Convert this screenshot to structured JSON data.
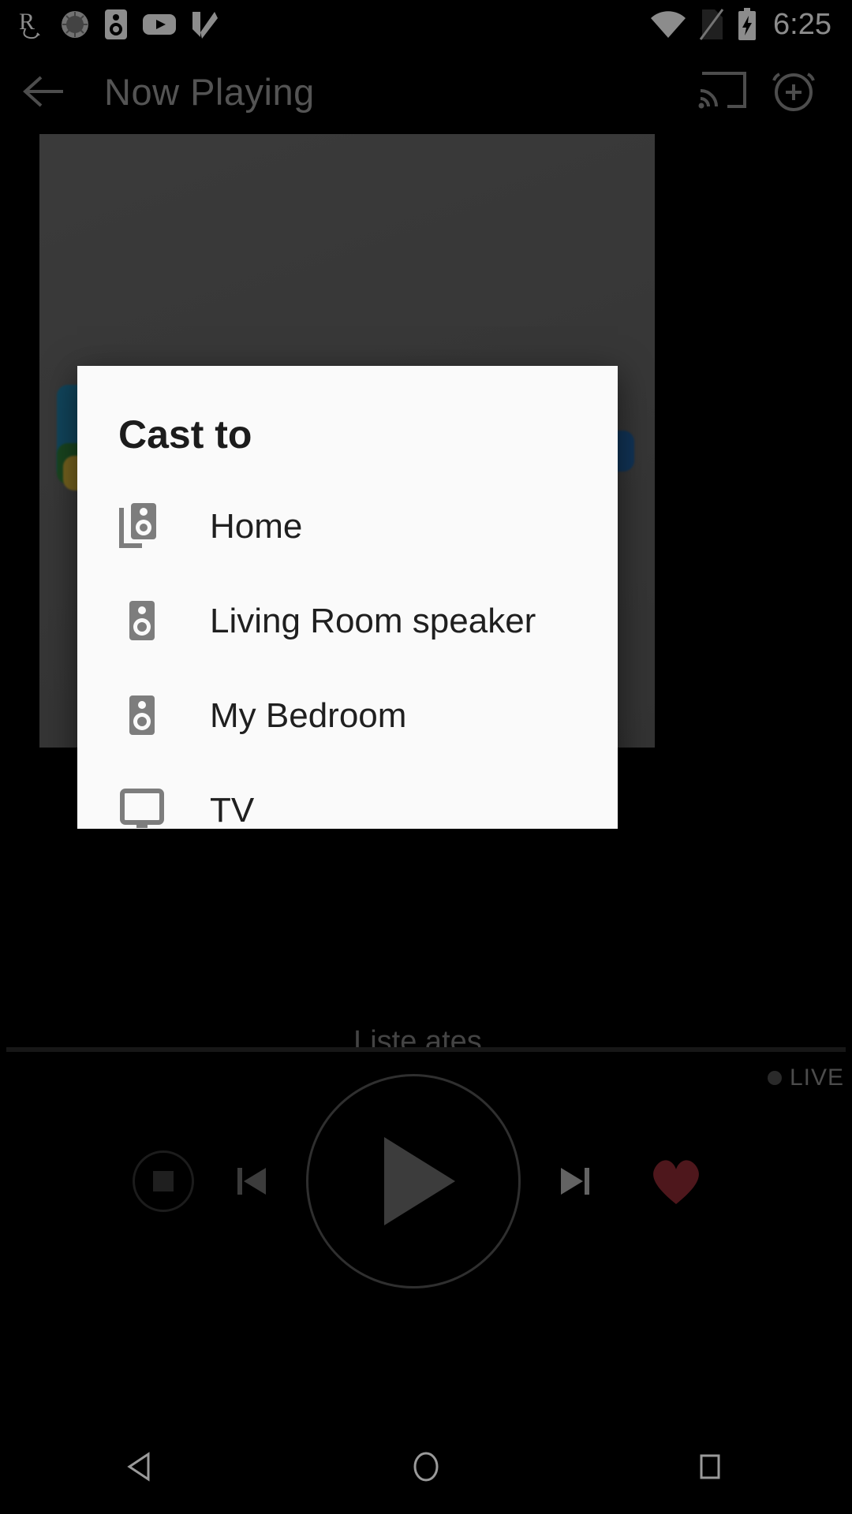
{
  "status_bar": {
    "time": "6:25",
    "left_icons": [
      {
        "name": "bible-app-icon",
        "glyph": "R"
      },
      {
        "name": "sunrise-alarm-icon",
        "glyph": "●"
      },
      {
        "name": "speaker-app-icon",
        "glyph": "▣"
      },
      {
        "name": "youtube-icon",
        "glyph": "▶"
      },
      {
        "name": "checkmark-app-icon",
        "glyph": "✔"
      }
    ],
    "right_icons": [
      {
        "name": "wifi-icon"
      },
      {
        "name": "no-sim-icon"
      },
      {
        "name": "battery-charging-icon"
      }
    ]
  },
  "app_bar": {
    "title": "Now Playing",
    "back_icon": "arrow-back-icon",
    "cast_icon": "cast-icon",
    "alarm_add_icon": "alarm-add-icon"
  },
  "now_playing": {
    "subtitle": "Liste                                      ates..",
    "live_label": "LIVE",
    "progress_percent": 100
  },
  "controls": {
    "stop": "stop-button",
    "previous": "previous-track-button",
    "play": "play-button",
    "next": "next-track-button",
    "favorite": "favorite-button",
    "favorite_color": "#8e2b33"
  },
  "dialog": {
    "title": "Cast to",
    "devices": [
      {
        "label": "Home",
        "icon": "speaker-group-icon"
      },
      {
        "label": "Living Room speaker",
        "icon": "speaker-icon"
      },
      {
        "label": "My Bedroom",
        "icon": "speaker-icon"
      },
      {
        "label": "TV",
        "icon": "tv-icon"
      }
    ]
  },
  "nav_bar": {
    "back": "nav-back-button",
    "home": "nav-home-button",
    "recents": "nav-recents-button"
  },
  "colors": {
    "dialog_bg": "#fafafa",
    "accent_heart": "#8e2b33",
    "app_bar_text": "#9a9a9a",
    "screen_bg": "#000000"
  }
}
